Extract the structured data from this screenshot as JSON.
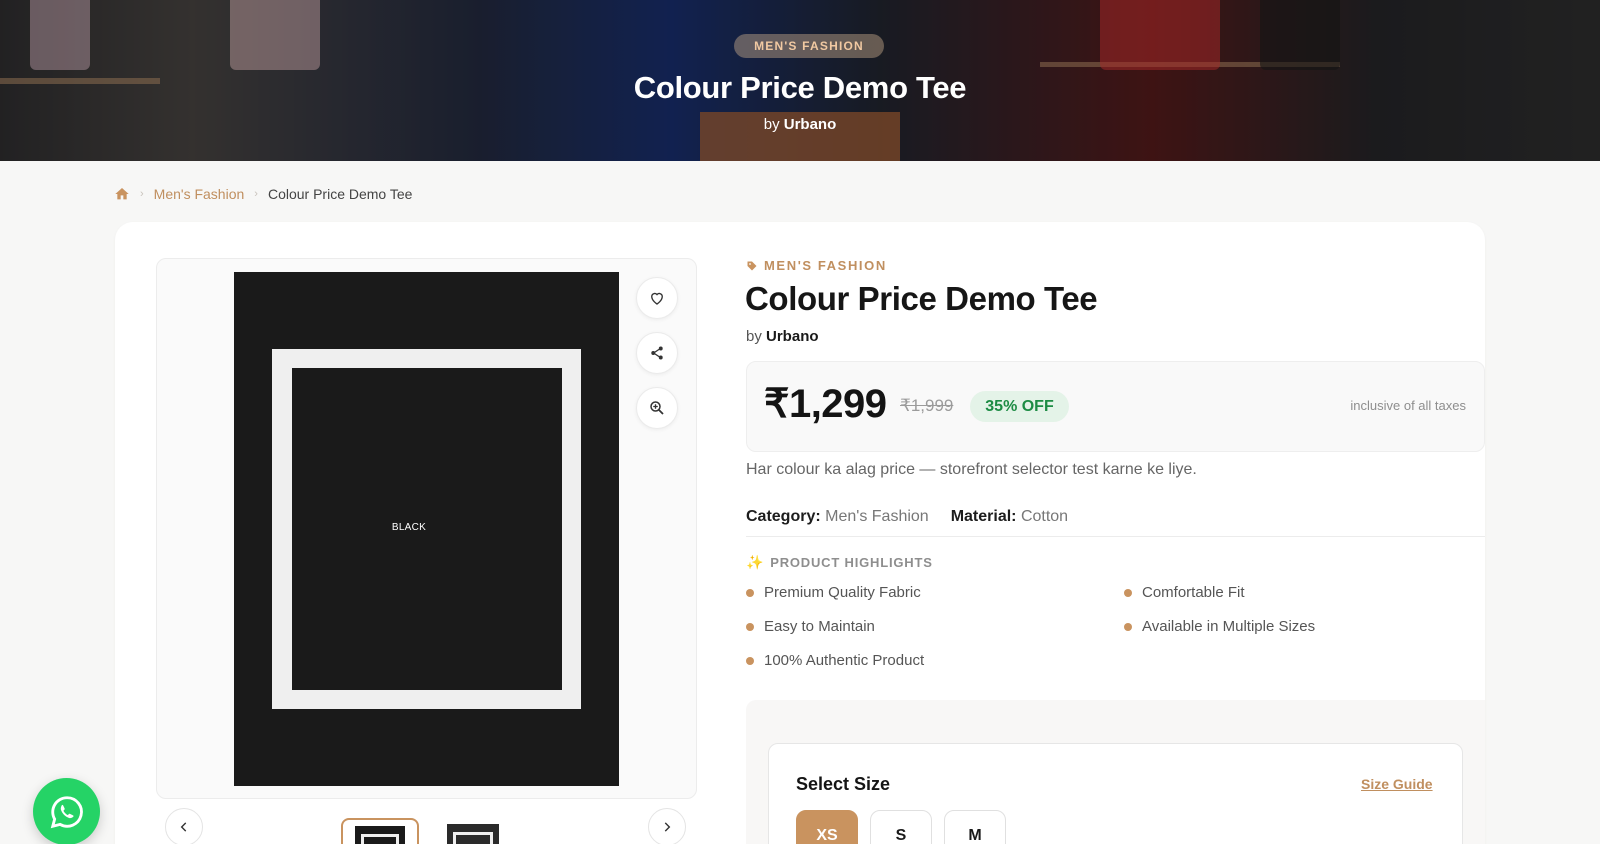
{
  "hero": {
    "category_tag": "MEN'S FASHION",
    "title": "Colour Price Demo Tee",
    "by_prefix": "by",
    "brand": "Urbano"
  },
  "breadcrumb": {
    "home_icon": "home-icon",
    "items": [
      "Men's Fashion",
      "Colour Price Demo Tee"
    ],
    "separator": "›"
  },
  "gallery": {
    "image_label": "BLACK",
    "actions": [
      "heart-icon",
      "share-icon",
      "zoom-in-icon"
    ],
    "prev_icon": "chevron-left-icon",
    "next_icon": "chevron-right-icon",
    "thumb_count": 2
  },
  "product": {
    "category": "MEN'S FASHION",
    "title": "Colour Price Demo Tee",
    "by_prefix": "by",
    "brand": "Urbano",
    "price": "₹1,299",
    "mrp": "₹1,999",
    "discount": "35% OFF",
    "tax_note": "inclusive of all taxes",
    "description": "Har colour ka alag price — storefront selector test karne ke liye.",
    "meta": [
      {
        "label": "Category:",
        "value": "Men's Fashion"
      },
      {
        "label": "Material:",
        "value": "Cotton"
      }
    ],
    "highlights_title": "PRODUCT HIGHLIGHTS",
    "highlights": [
      "Premium Quality Fabric",
      "Comfortable Fit",
      "Easy to Maintain",
      "Available in Multiple Sizes",
      "100% Authentic Product"
    ]
  },
  "size_selector": {
    "title": "Select Size",
    "guide_label": "Size Guide",
    "options": [
      "XS",
      "S",
      "M"
    ],
    "selected": "XS"
  },
  "colors": {
    "accent": "#c9935f",
    "accent_text": "#c08f5f",
    "discount_green": "#1d8c44",
    "whatsapp": "#25d366"
  },
  "floating": {
    "whatsapp_icon": "whatsapp-icon"
  }
}
